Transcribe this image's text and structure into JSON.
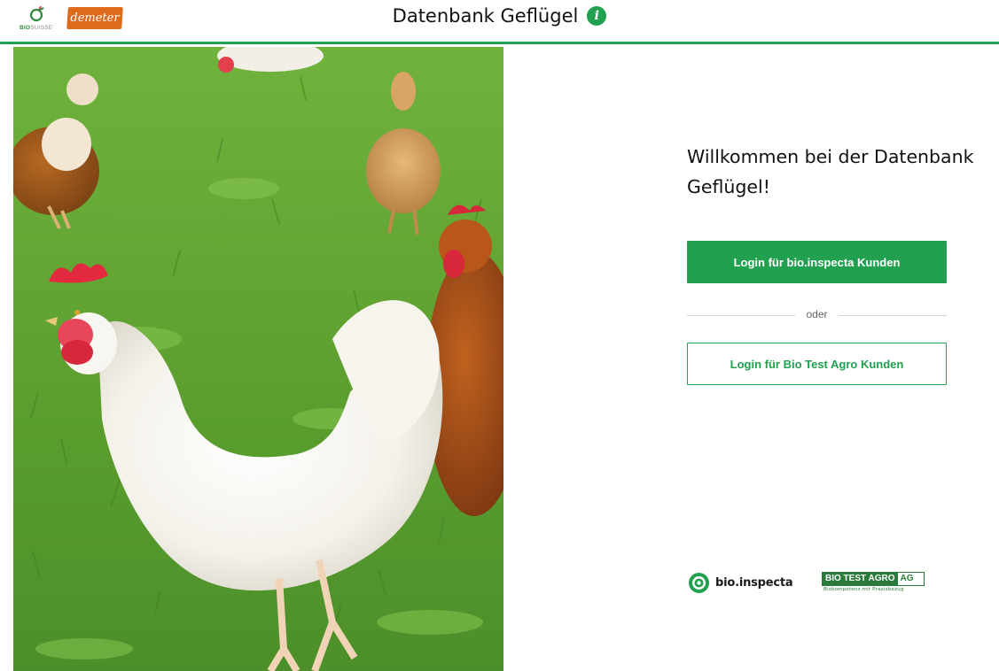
{
  "header": {
    "title": "Datenbank Geflügel",
    "info_icon": "info-icon",
    "logos": {
      "bio_suisse": {
        "bio": "BIO",
        "suisse": "SUISSE"
      },
      "demeter": "demeter"
    }
  },
  "hero_image": {
    "subject": "chickens-on-grass-photo"
  },
  "main": {
    "welcome": "Willkommen bei der Datenbank Geflügel!",
    "login_bio_inspecta": "Login für bio.inspecta Kunden",
    "divider_text": "oder",
    "login_bio_test_agro": "Login für Bio Test Agro Kunden"
  },
  "footer": {
    "bio_inspecta": "bio.inspecta",
    "bio_test_agro": {
      "dark": "BIO TEST AGRO",
      "light": "AG",
      "tagline": "Biokompetenz mit Praxisbezug"
    }
  },
  "colors": {
    "accent": "#21a04f",
    "demeter_orange": "#e06a1c"
  }
}
